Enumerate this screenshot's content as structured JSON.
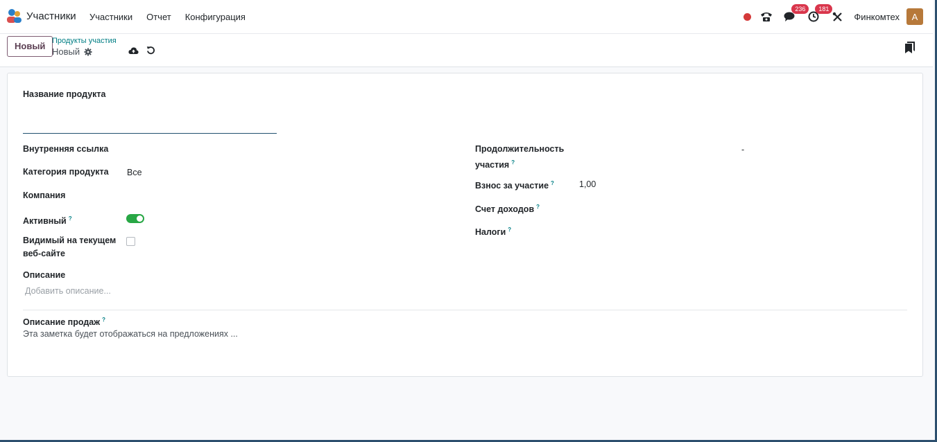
{
  "app": {
    "name": "Участники",
    "menu": [
      "Участники",
      "Отчет",
      "Конфигурация"
    ]
  },
  "systray": {
    "messages_count": "236",
    "activities_count": "181",
    "company": "Финкомтех",
    "avatar_letter": "A"
  },
  "control_panel": {
    "new_button": "Новый",
    "breadcrumb": "Продукты участия",
    "record_name": "Новый"
  },
  "form": {
    "product_name_label": "Название продукта",
    "internal_ref_label": "Внутренняя ссылка",
    "category_label": "Категория продукта",
    "category_value": "Все",
    "company_label": "Компания",
    "active_label": "Активный",
    "active_value": true,
    "website_label_1": "Видимый на текущем",
    "website_label_2": "веб-сайте",
    "website_value": false,
    "description_label": "Описание",
    "description_placeholder": "Добавить описание...",
    "duration_label_1": "Продолжительность",
    "duration_label_2": "участия",
    "duration_value": "-",
    "fee_label": "Взнос за участие",
    "fee_value": "1,00",
    "income_account_label": "Счет доходов",
    "taxes_label": "Налоги",
    "sales_description_label": "Описание продаж",
    "sales_description_placeholder": "Эта заметка будет отображаться на предложениях ..."
  },
  "colors": {
    "accent": "#017e84",
    "brand": "#714b67",
    "toggle_on": "#28a745",
    "badge": "#d9364c"
  }
}
